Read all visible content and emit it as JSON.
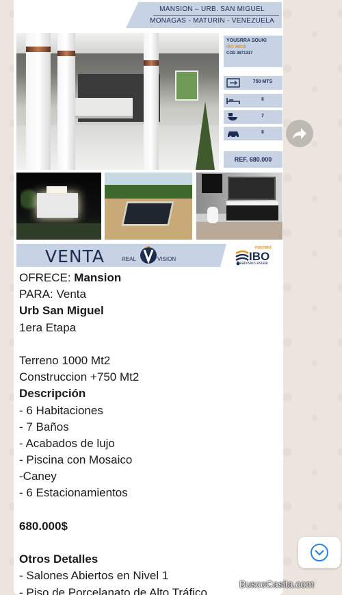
{
  "flyer": {
    "address_line1": "MANSION – URB. SAN MIGUEL",
    "address_line2": "MONAGAS - MATURIN - VENEZUELA",
    "agent_name": "YOUSRRA SOUKI",
    "agent_ibo": "IBO 48935",
    "property_code": "COD 3671317",
    "stats": [
      {
        "icon": "area-icon",
        "value": "750 MTS"
      },
      {
        "icon": "bed-icon",
        "value": "6"
      },
      {
        "icon": "toilet-icon",
        "value": "7"
      },
      {
        "icon": "car-icon",
        "value": "6"
      }
    ],
    "ref": "REF. 680.000",
    "sale_label": "VENTA",
    "brand_real": "REAL",
    "brand_vision": "VISION",
    "ibo_tag": "VISIONBIZ",
    "ibo_logo": "IBO",
    "ibo_url": "Realvision.estate"
  },
  "message": {
    "offer_label": "OFRECE:",
    "offer_value": "Mansion",
    "for_label": "PARA:",
    "for_value": "Venta",
    "location": "Urb San Miguel",
    "stage": "1era Etapa",
    "land": "Terreno 1000 Mt2",
    "construction": "Construccion +750 Mt2",
    "description_title": "Descripción",
    "features": [
      "- 6 Habitaciones",
      "- 7 Baños",
      "- Acabados de lujo",
      "- Piscina con Mosaico",
      "-Caney",
      "- 6 Estacionamientos"
    ],
    "price": "680.000$",
    "other_title": "Otros Detalles",
    "other_details": [
      "- Salones Abiertos en Nivel 1",
      "- Piso de Porcelanato de Alto Tráfico"
    ]
  },
  "watermark": "BuscoCasita.com",
  "colors": {
    "flyer_blue": "#c7d3e4",
    "navy": "#1d2d52",
    "orange": "#e0932a",
    "chat_bg": "#ece5dd"
  }
}
